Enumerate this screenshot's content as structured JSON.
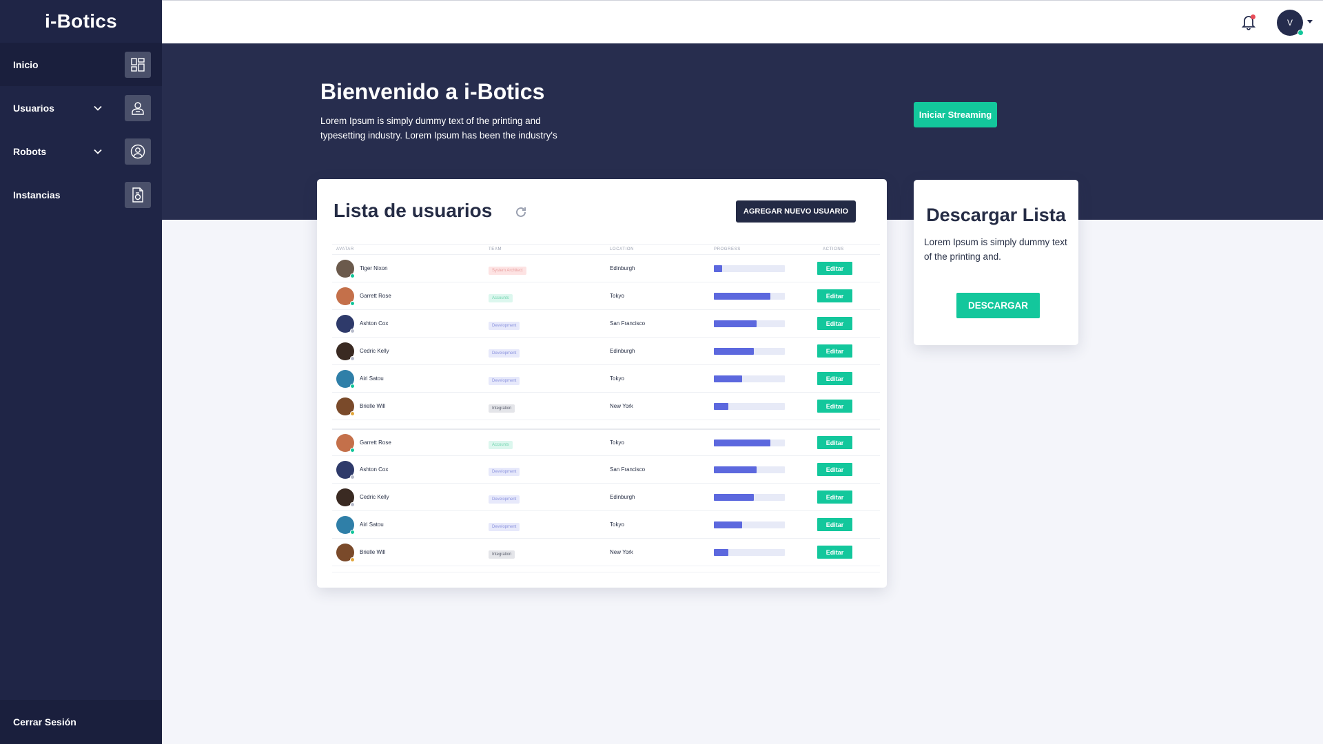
{
  "app": {
    "brand": "i-Botics"
  },
  "sidebar": {
    "items": [
      {
        "label": "Inicio",
        "icon": "dashboard-icon"
      },
      {
        "label": "Usuarios",
        "icon": "user-icon"
      },
      {
        "label": "Robots",
        "icon": "robot-icon"
      },
      {
        "label": "Instancias",
        "icon": "document-icon"
      }
    ],
    "logout": "Cerrar Sesión"
  },
  "topbar": {
    "avatar_initial": "V"
  },
  "hero": {
    "title": "Bienvenido a i-Botics",
    "description": "Lorem Ipsum is simply dummy text of the printing and typesetting industry. Lorem Ipsum has been the industry's",
    "stream_button": "Iniciar Streaming"
  },
  "users_card": {
    "title": "Lista de usuarios",
    "add_button": "AGREGAR NUEVO USUARIO",
    "headers": [
      "Avatar",
      "Team",
      "Location",
      "Progress",
      "Actions"
    ],
    "edit_label": "Editar",
    "rows": [
      {
        "name": "Tiger Nixon",
        "team": "System Architect",
        "location": "Edinburgh",
        "progress": 0.12
      },
      {
        "name": "Garrett Rose",
        "team": "Accounts",
        "location": "Tokyo",
        "progress": 0.8
      },
      {
        "name": "Ashton Cox",
        "team": "Development",
        "location": "San Francisco",
        "progress": 0.6
      },
      {
        "name": "Cedric Kelly",
        "team": "Development",
        "location": "Edinburgh",
        "progress": 0.56
      },
      {
        "name": "Airi Satou",
        "team": "Development",
        "location": "Tokyo",
        "progress": 0.4
      },
      {
        "name": "Brielle Will",
        "team": "Integration",
        "location": "New York",
        "progress": 0.2
      },
      {
        "name": "Garrett Rose",
        "team": "Accounts",
        "location": "Tokyo",
        "progress": 0.8
      },
      {
        "name": "Ashton Cox",
        "team": "Development",
        "location": "San Francisco",
        "progress": 0.6
      },
      {
        "name": "Cedric Kelly",
        "team": "Development",
        "location": "Edinburgh",
        "progress": 0.56
      },
      {
        "name": "Airi Satou",
        "team": "Development",
        "location": "Tokyo",
        "progress": 0.4
      },
      {
        "name": "Brielle Will",
        "team": "Integration",
        "location": "New York",
        "progress": 0.2
      }
    ]
  },
  "download_card": {
    "title": "Descargar Lista",
    "description": "Lorem Ipsum is simply dummy text of the printing and.",
    "button": "DESCARGAR"
  },
  "colors": {
    "sidebar": "#1f2546",
    "hero": "#272d4e",
    "accent_green": "#13c79c",
    "progress": "#5c68de",
    "notification_dot": "#e84b57"
  }
}
